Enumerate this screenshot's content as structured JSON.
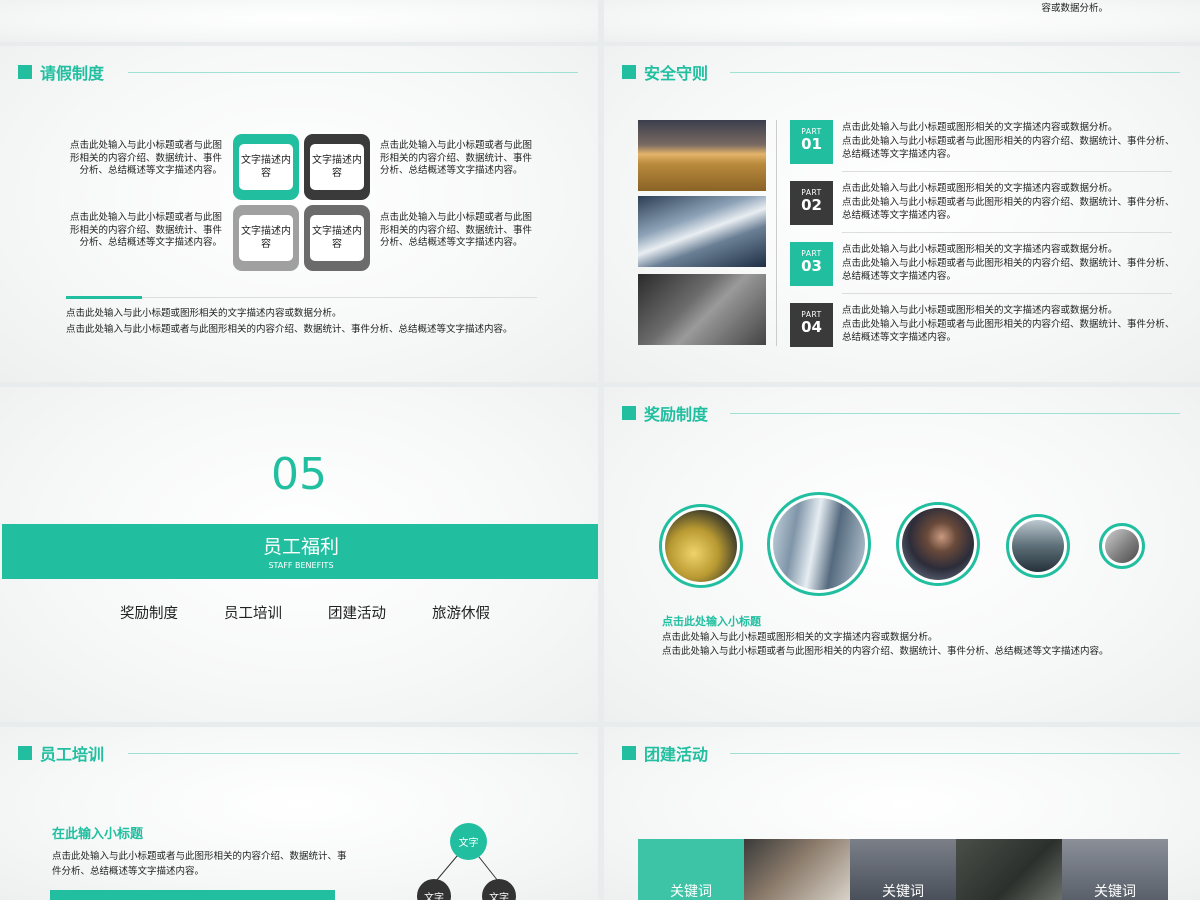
{
  "top_note": "容或数据分析。",
  "leave": {
    "title": "请假制度",
    "text_tl": "点击此处输入与此小标题或者与此图形相关的内容介绍、数据统计、事件分析、总结概述等文字描述内容。",
    "text_tr": "点击此处输入与此小标题或者与此图形相关的内容介绍、数据统计、事件分析、总结概述等文字描述内容。",
    "text_bl": "点击此处输入与此小标题或者与此图形相关的内容介绍、数据统计、事件分析、总结概述等文字描述内容。",
    "text_br": "点击此处输入与此小标题或者与此图形相关的内容介绍、数据统计、事件分析、总结概述等文字描述内容。",
    "tiles": [
      "文字描述内容",
      "文字描述内容",
      "文字描述内容",
      "文字描述内容"
    ],
    "bottom_line1": "点击此处输入与此小标题或图形相关的文字描述内容或数据分析。",
    "bottom_line2": "点击此处输入与此小标题或者与此图形相关的内容介绍、数据统计、事件分析、总结概述等文字描述内容。",
    "colors": {
      "teal": "#21bfa0",
      "dark": "#3a3a3a",
      "gray": "#a0a0a0",
      "mid": "#6b6b6b"
    }
  },
  "safety": {
    "title": "安全守则",
    "parts": [
      {
        "label": "PART",
        "num": "01",
        "line1": "点击此处输入与此小标题或图形相关的文字描述内容或数据分析。",
        "line2": "点击此处输入与此小标题或者与此图形相关的内容介绍、数据统计、事件分析、总结概述等文字描述内容。"
      },
      {
        "label": "PART",
        "num": "02",
        "line1": "点击此处输入与此小标题或图形相关的文字描述内容或数据分析。",
        "line2": "点击此处输入与此小标题或者与此图形相关的内容介绍、数据统计、事件分析、总结概述等文字描述内容。"
      },
      {
        "label": "PART",
        "num": "03",
        "line1": "点击此处输入与此小标题或图形相关的文字描述内容或数据分析。",
        "line2": "点击此处输入与此小标题或者与此图形相关的内容介绍、数据统计、事件分析、总结概述等文字描述内容。"
      },
      {
        "label": "PART",
        "num": "04",
        "line1": "点击此处输入与此小标题或图形相关的文字描述内容或数据分析。",
        "line2": "点击此处输入与此小标题或者与此图形相关的内容介绍、数据统计、事件分析、总结概述等文字描述内容。"
      }
    ]
  },
  "section": {
    "number": "05",
    "title": "员工福利",
    "subtitle": "STAFF BENEFITS",
    "items": [
      "奖励制度",
      "员工培训",
      "团建活动",
      "旅游休假"
    ]
  },
  "reward": {
    "title": "奖励制度",
    "subtitle": "点击此处输入小标题",
    "line1": "点击此处输入与此小标题或图形相关的文字描述内容或数据分析。",
    "line2": "点击此处输入与此小标题或者与此图形相关的内容介绍、数据统计、事件分析、总结概述等文字描述内容。"
  },
  "training": {
    "title": "员工培训",
    "subtitle": "在此输入小标题",
    "body": "点击此处输入与此小标题或者与此图形相关的内容介绍、数据统计、事件分析、总结概述等文字描述内容。",
    "node_top": "文字",
    "node_left": "文字",
    "node_right": "文字"
  },
  "team": {
    "title": "团建活动",
    "keywords": [
      "关键词",
      "关键词",
      "关键词"
    ]
  }
}
